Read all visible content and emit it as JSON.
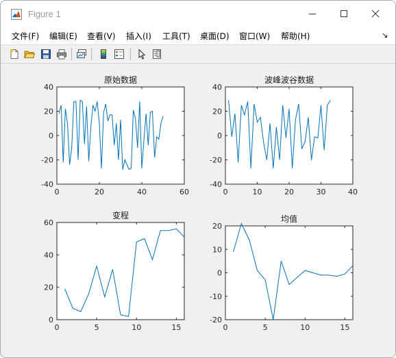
{
  "window": {
    "title": "Figure 1",
    "controls": [
      "minimize",
      "maximize",
      "close"
    ]
  },
  "menu": {
    "items": [
      {
        "id": "file",
        "label": "文件(F)"
      },
      {
        "id": "edit",
        "label": "编辑(E)"
      },
      {
        "id": "view",
        "label": "查看(V)"
      },
      {
        "id": "insert",
        "label": "插入(I)"
      },
      {
        "id": "tools",
        "label": "工具(T)"
      },
      {
        "id": "desktop",
        "label": "桌面(D)"
      },
      {
        "id": "window",
        "label": "窗口(W)"
      },
      {
        "id": "help",
        "label": "帮助(H)"
      }
    ],
    "overflow_icon": "dock-arrow-icon"
  },
  "toolbar": {
    "icons": [
      "new-figure-icon",
      "open-icon",
      "save-icon",
      "print-icon",
      "link-plot-icon",
      "colorbar-icon",
      "legend-icon",
      "edit-plot-arrow-icon",
      "property-inspector-icon"
    ]
  },
  "colors": {
    "line": "#0072bd",
    "axes": "#262626",
    "axes_background": "#ffffff",
    "figure_background": "#f0f0f0"
  },
  "chart_data": [
    {
      "type": "line",
      "title": "原始数据",
      "xlabel": "",
      "ylabel": "",
      "xlim": [
        0,
        60
      ],
      "ylim": [
        -40,
        40
      ],
      "xticks": [
        0,
        20,
        40,
        60
      ],
      "yticks": [
        -40,
        -20,
        0,
        20,
        40
      ],
      "grid": false,
      "x": [
        1,
        2,
        3,
        4,
        5,
        6,
        7,
        8,
        9,
        10,
        11,
        12,
        13,
        14,
        15,
        16,
        17,
        18,
        19,
        20,
        21,
        22,
        23,
        24,
        25,
        26,
        27,
        28,
        29,
        30,
        31,
        32,
        33,
        34,
        35,
        36,
        37,
        38,
        39,
        40,
        41,
        42,
        43,
        44,
        45,
        46,
        47,
        48,
        49,
        50
      ],
      "y": [
        18,
        25,
        -22,
        22,
        10,
        -24,
        -10,
        28,
        28,
        -20,
        29,
        28,
        -7,
        24,
        -21,
        7,
        25,
        20,
        28,
        10,
        -27,
        19,
        26,
        12,
        17,
        17,
        -8,
        10,
        -20,
        13,
        -28,
        -20,
        -24,
        -28,
        -27,
        21,
        14,
        -10,
        28,
        -27,
        -3,
        18,
        -8,
        19,
        20,
        -18,
        -1,
        -3,
        10,
        16
      ]
    },
    {
      "type": "line",
      "title": "波峰波谷数据",
      "xlabel": "",
      "ylabel": "",
      "xlim": [
        0,
        40
      ],
      "ylim": [
        -40,
        40
      ],
      "xticks": [
        0,
        10,
        20,
        30,
        40
      ],
      "yticks": [
        -40,
        -20,
        0,
        20,
        40
      ],
      "grid": false,
      "x": [
        1,
        2,
        3,
        4,
        5,
        6,
        7,
        8,
        9,
        10,
        11,
        12,
        13,
        14,
        15,
        16,
        17,
        18,
        19,
        20,
        21,
        22,
        23,
        24,
        25,
        26,
        27,
        28,
        29,
        30,
        31,
        32,
        33
      ],
      "y": [
        29,
        -1,
        18,
        -22,
        25,
        17,
        28,
        -27,
        26,
        11,
        15,
        -6,
        -20,
        10,
        -27,
        7,
        -20,
        25,
        -2,
        22,
        -27,
        13,
        26,
        -11,
        -5,
        15,
        -20,
        -1,
        -2,
        25,
        -12,
        25,
        29
      ]
    },
    {
      "type": "line",
      "title": "变程",
      "xlabel": "",
      "ylabel": "",
      "xlim": [
        0,
        16
      ],
      "ylim": [
        0,
        60
      ],
      "xticks": [
        0,
        5,
        10,
        15
      ],
      "yticks": [
        0,
        20,
        40,
        60
      ],
      "grid": false,
      "x": [
        1,
        2,
        3,
        4,
        5,
        6,
        7,
        8,
        9,
        10,
        11,
        12,
        13,
        14,
        15,
        16
      ],
      "y": [
        19,
        7,
        5,
        16,
        33,
        14,
        31,
        3,
        2,
        48,
        50,
        37,
        55,
        55,
        56,
        51
      ]
    },
    {
      "type": "line",
      "title": "均值",
      "xlabel": "",
      "ylabel": "",
      "xlim": [
        0,
        16
      ],
      "ylim": [
        -20,
        20
      ],
      "xticks": [
        0,
        5,
        10,
        15
      ],
      "yticks": [
        -20,
        -10,
        0,
        10,
        20
      ],
      "grid": false,
      "x": [
        1,
        2,
        3,
        4,
        5,
        6,
        7,
        8,
        9,
        10,
        11,
        12,
        13,
        14,
        15,
        16
      ],
      "y": [
        9,
        21,
        14,
        1,
        -3,
        -20,
        5,
        -5,
        -2,
        1,
        0,
        -1,
        -1,
        -1.5,
        -0.5,
        3
      ]
    }
  ]
}
